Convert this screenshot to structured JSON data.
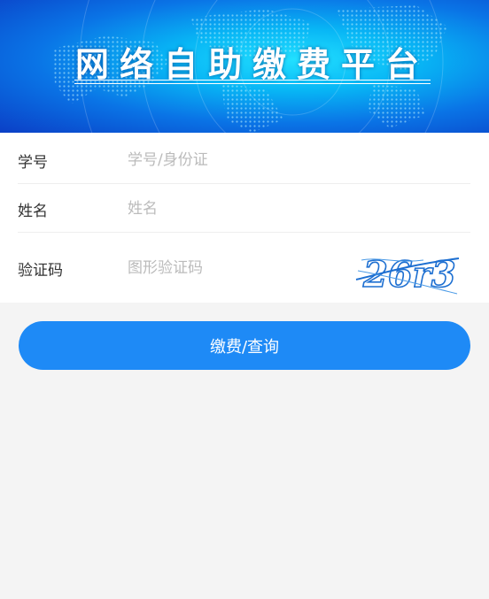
{
  "banner": {
    "title": "网络自助缴费平台"
  },
  "form": {
    "student_id": {
      "label": "学号",
      "placeholder": "学号/身份证",
      "value": ""
    },
    "name": {
      "label": "姓名",
      "placeholder": "姓名",
      "value": ""
    },
    "captcha": {
      "label": "验证码",
      "placeholder": "图形验证码",
      "value": "",
      "image_text": "26r3"
    }
  },
  "submit": {
    "label": "缴费/查询"
  },
  "colors": {
    "accent": "#1e8af6",
    "page_background": "#f4f4f4",
    "banner_dark": "#0b3fc6",
    "banner_light": "#22e0ff"
  }
}
